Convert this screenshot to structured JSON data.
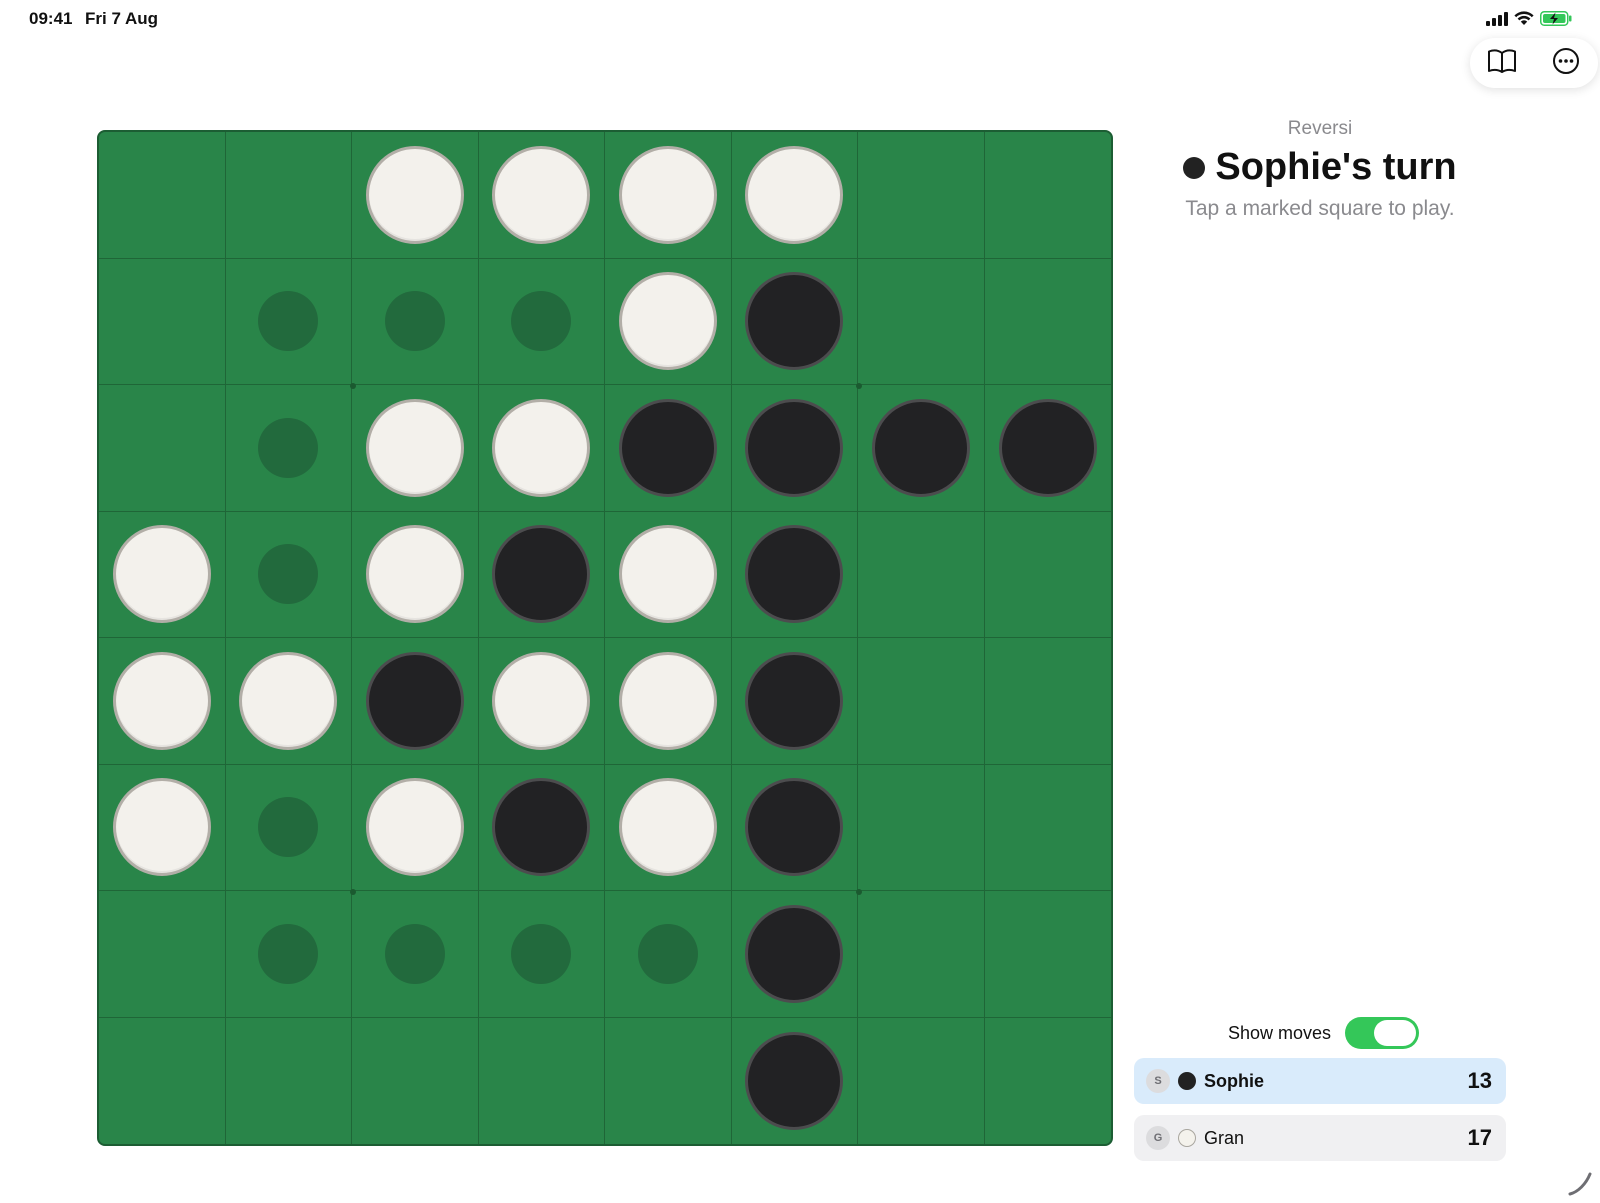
{
  "status_bar": {
    "time": "09:41",
    "date": "Fri 7 Aug",
    "icons": [
      "signal-icon",
      "wifi-icon",
      "battery-charging-icon"
    ]
  },
  "toolbar": {
    "buttons": [
      "rules-book-icon",
      "more-options-icon"
    ]
  },
  "header": {
    "app_name": "Reversi",
    "turn_title": "Sophie's turn",
    "turn_disc": "black",
    "instruction": "Tap a marked square to play."
  },
  "board": {
    "size": 8,
    "legend": {
      "W": "white disc",
      "B": "black disc",
      "h": "legal move marker",
      ".": "empty"
    },
    "rows": [
      "..WWWW..",
      ".hhhWB..",
      ".hWWBBBB",
      "WhWBWB..",
      "WWBWWB..",
      "WhWBWB..",
      ".hhhhB..",
      ".....B.."
    ]
  },
  "settings": {
    "show_moves_label": "Show moves",
    "show_moves_on": true
  },
  "players": [
    {
      "initial": "S",
      "name": "Sophie",
      "disc": "black",
      "score": "13",
      "active": true
    },
    {
      "initial": "G",
      "name": "Gran",
      "disc": "white",
      "score": "17",
      "active": false
    }
  ],
  "colors": {
    "board_green": "#298549",
    "marker_green": "#226a3d",
    "toggle_green": "#34c759",
    "active_row": "#d9ebfb"
  }
}
